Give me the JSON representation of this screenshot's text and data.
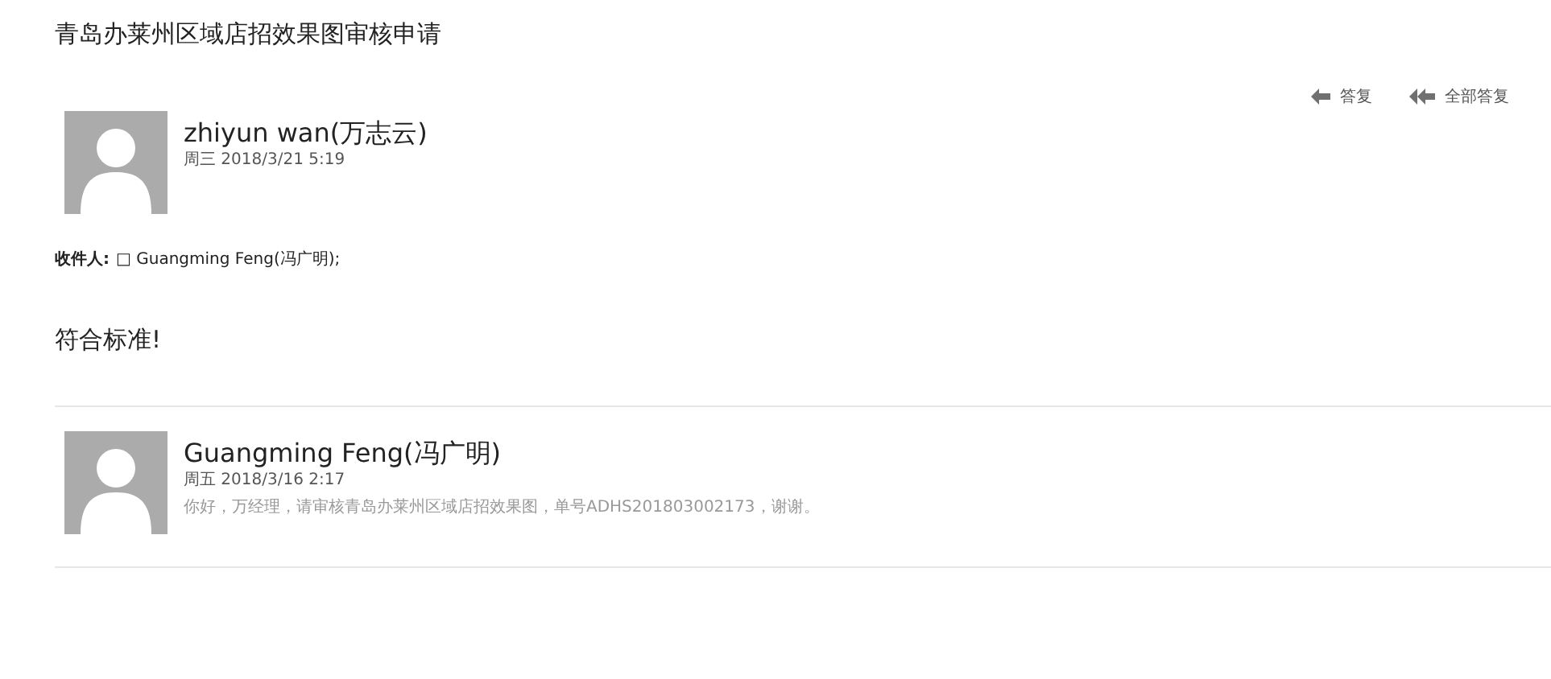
{
  "title": "青岛办莱州区域店招效果图审核申请",
  "actions": [
    {
      "kind": "reply",
      "label": "答复"
    },
    {
      "kind": "reply_all",
      "label": "全部答复"
    }
  ],
  "message": {
    "sender": "zhiyun wan(万志云)",
    "date": "周三 2018/3/21 5:19",
    "recipients_label": "收件人:",
    "recipients": "□ Guangming Feng(冯广明);",
    "body": "符合标准!"
  },
  "history": [
    {
      "sender": "Guangming Feng(冯广明)",
      "date": "周五 2018/3/16 2:17",
      "preview": "你好，万经理，请审核青岛办莱州区域店招效果图，单号ADHS201803002173，谢谢。"
    }
  ]
}
